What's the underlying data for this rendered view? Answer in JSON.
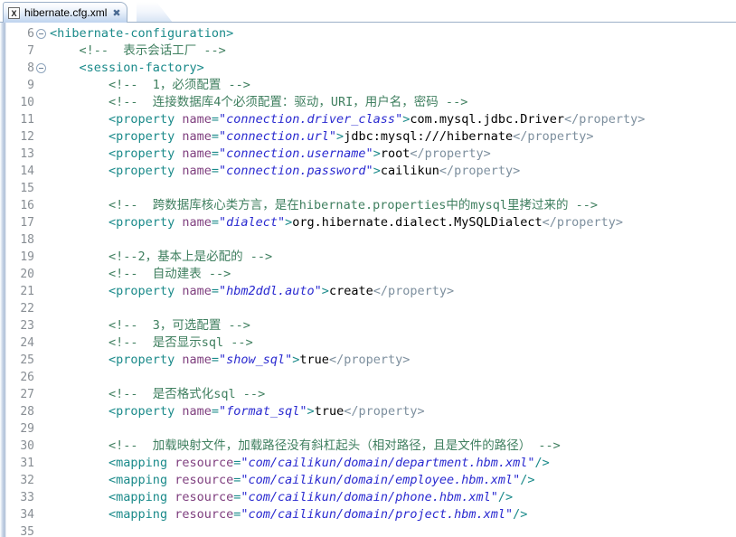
{
  "window": {
    "title": "hibernate.cfg.xml"
  },
  "tab": {
    "icon_label": "X",
    "icon_name": "xml-file-icon",
    "title": "hibernate.cfg.xml",
    "close_glyph": "✖"
  },
  "colors": {
    "comment": "#3f7f5f",
    "tag": "#1a8a8a",
    "attribute_name": "#7f3f7f",
    "attribute_value": "#2a2ad0",
    "text": "#000000",
    "closing_tag": "#7d8f9e",
    "line_number": "#888e94",
    "background": "#ffffff",
    "tab_border": "#9cb0c8"
  },
  "editor": {
    "first_line": 6,
    "last_line": 35,
    "lines": [
      {
        "number": "6",
        "fold": true,
        "indent": 0,
        "tokens": [
          {
            "t": "pn",
            "s": "<"
          },
          {
            "t": "tg",
            "s": "hibernate-configuration"
          },
          {
            "t": "pn",
            "s": ">"
          }
        ]
      },
      {
        "number": "7",
        "fold": false,
        "indent": 4,
        "tokens": [
          {
            "t": "cm",
            "s": "<!--  表示会话工厂 -->"
          }
        ]
      },
      {
        "number": "8",
        "fold": true,
        "indent": 4,
        "tokens": [
          {
            "t": "pn",
            "s": "<"
          },
          {
            "t": "tg",
            "s": "session-factory"
          },
          {
            "t": "pn",
            "s": ">"
          }
        ]
      },
      {
        "number": "9",
        "fold": false,
        "indent": 8,
        "tokens": [
          {
            "t": "cm",
            "s": "<!--  1，必须配置 -->"
          }
        ]
      },
      {
        "number": "10",
        "fold": false,
        "indent": 8,
        "tokens": [
          {
            "t": "cm",
            "s": "<!--  连接数据库4个必须配置：驱动，URI，用户名，密码 -->"
          }
        ]
      },
      {
        "number": "11",
        "fold": false,
        "indent": 8,
        "tokens": [
          {
            "t": "pn",
            "s": "<"
          },
          {
            "t": "tg",
            "s": "property"
          },
          {
            "t": "tx",
            "s": " "
          },
          {
            "t": "at",
            "s": "name"
          },
          {
            "t": "pn",
            "s": "="
          },
          {
            "t": "vl",
            "s": "\"connection.driver_class\""
          },
          {
            "t": "pn",
            "s": ">"
          },
          {
            "t": "tx",
            "s": "com.mysql.jdbc.Driver"
          },
          {
            "t": "ct",
            "s": "</property>"
          }
        ]
      },
      {
        "number": "12",
        "fold": false,
        "indent": 8,
        "tokens": [
          {
            "t": "pn",
            "s": "<"
          },
          {
            "t": "tg",
            "s": "property"
          },
          {
            "t": "tx",
            "s": " "
          },
          {
            "t": "at",
            "s": "name"
          },
          {
            "t": "pn",
            "s": "="
          },
          {
            "t": "vl",
            "s": "\"connection.url\""
          },
          {
            "t": "pn",
            "s": ">"
          },
          {
            "t": "tx",
            "s": "jdbc:mysql:///hibernate"
          },
          {
            "t": "ct",
            "s": "</property>"
          }
        ]
      },
      {
        "number": "13",
        "fold": false,
        "indent": 8,
        "tokens": [
          {
            "t": "pn",
            "s": "<"
          },
          {
            "t": "tg",
            "s": "property"
          },
          {
            "t": "tx",
            "s": " "
          },
          {
            "t": "at",
            "s": "name"
          },
          {
            "t": "pn",
            "s": "="
          },
          {
            "t": "vl",
            "s": "\"connection.username\""
          },
          {
            "t": "pn",
            "s": ">"
          },
          {
            "t": "tx",
            "s": "root"
          },
          {
            "t": "ct",
            "s": "</property>"
          }
        ]
      },
      {
        "number": "14",
        "fold": false,
        "indent": 8,
        "tokens": [
          {
            "t": "pn",
            "s": "<"
          },
          {
            "t": "tg",
            "s": "property"
          },
          {
            "t": "tx",
            "s": " "
          },
          {
            "t": "at",
            "s": "name"
          },
          {
            "t": "pn",
            "s": "="
          },
          {
            "t": "vl",
            "s": "\"connection.password\""
          },
          {
            "t": "pn",
            "s": ">"
          },
          {
            "t": "tx",
            "s": "cailikun"
          },
          {
            "t": "ct",
            "s": "</property>"
          }
        ]
      },
      {
        "number": "15",
        "fold": false,
        "indent": 0,
        "tokens": []
      },
      {
        "number": "16",
        "fold": false,
        "indent": 8,
        "tokens": [
          {
            "t": "cm",
            "s": "<!--  跨数据库核心类方言，是在hibernate.properties中的mysql里拷过来的 -->"
          }
        ]
      },
      {
        "number": "17",
        "fold": false,
        "indent": 8,
        "tokens": [
          {
            "t": "pn",
            "s": "<"
          },
          {
            "t": "tg",
            "s": "property"
          },
          {
            "t": "tx",
            "s": " "
          },
          {
            "t": "at",
            "s": "name"
          },
          {
            "t": "pn",
            "s": "="
          },
          {
            "t": "vl",
            "s": "\"dialect\""
          },
          {
            "t": "pn",
            "s": ">"
          },
          {
            "t": "tx",
            "s": "org.hibernate.dialect.MySQLDialect"
          },
          {
            "t": "ct",
            "s": "</property>"
          }
        ]
      },
      {
        "number": "18",
        "fold": false,
        "indent": 0,
        "tokens": []
      },
      {
        "number": "19",
        "fold": false,
        "indent": 8,
        "tokens": [
          {
            "t": "cm",
            "s": "<!--2，基本上是必配的 -->"
          }
        ]
      },
      {
        "number": "20",
        "fold": false,
        "indent": 8,
        "tokens": [
          {
            "t": "cm",
            "s": "<!--  自动建表 -->"
          }
        ]
      },
      {
        "number": "21",
        "fold": false,
        "indent": 8,
        "tokens": [
          {
            "t": "pn",
            "s": "<"
          },
          {
            "t": "tg",
            "s": "property"
          },
          {
            "t": "tx",
            "s": " "
          },
          {
            "t": "at",
            "s": "name"
          },
          {
            "t": "pn",
            "s": "="
          },
          {
            "t": "vl",
            "s": "\"hbm2ddl.auto\""
          },
          {
            "t": "pn",
            "s": ">"
          },
          {
            "t": "tx",
            "s": "create"
          },
          {
            "t": "ct",
            "s": "</property>"
          }
        ]
      },
      {
        "number": "22",
        "fold": false,
        "indent": 0,
        "tokens": []
      },
      {
        "number": "23",
        "fold": false,
        "indent": 8,
        "tokens": [
          {
            "t": "cm",
            "s": "<!--  3，可选配置 -->"
          }
        ]
      },
      {
        "number": "24",
        "fold": false,
        "indent": 8,
        "tokens": [
          {
            "t": "cm",
            "s": "<!--  是否显示sql -->"
          }
        ]
      },
      {
        "number": "25",
        "fold": false,
        "indent": 8,
        "tokens": [
          {
            "t": "pn",
            "s": "<"
          },
          {
            "t": "tg",
            "s": "property"
          },
          {
            "t": "tx",
            "s": " "
          },
          {
            "t": "at",
            "s": "name"
          },
          {
            "t": "pn",
            "s": "="
          },
          {
            "t": "vl",
            "s": "\"show_sql\""
          },
          {
            "t": "pn",
            "s": ">"
          },
          {
            "t": "tx",
            "s": "true"
          },
          {
            "t": "ct",
            "s": "</property>"
          }
        ]
      },
      {
        "number": "26",
        "fold": false,
        "indent": 0,
        "tokens": []
      },
      {
        "number": "27",
        "fold": false,
        "indent": 8,
        "tokens": [
          {
            "t": "cm",
            "s": "<!--  是否格式化sql -->"
          }
        ]
      },
      {
        "number": "28",
        "fold": false,
        "indent": 8,
        "tokens": [
          {
            "t": "pn",
            "s": "<"
          },
          {
            "t": "tg",
            "s": "property"
          },
          {
            "t": "tx",
            "s": " "
          },
          {
            "t": "at",
            "s": "name"
          },
          {
            "t": "pn",
            "s": "="
          },
          {
            "t": "vl",
            "s": "\"format_sql\""
          },
          {
            "t": "pn",
            "s": ">"
          },
          {
            "t": "tx",
            "s": "true"
          },
          {
            "t": "ct",
            "s": "</property>"
          }
        ]
      },
      {
        "number": "29",
        "fold": false,
        "indent": 0,
        "tokens": []
      },
      {
        "number": "30",
        "fold": false,
        "indent": 8,
        "tokens": [
          {
            "t": "cm",
            "s": "<!--  加载映射文件，加载路径没有斜杠起头（相对路径，且是文件的路径） -->"
          }
        ]
      },
      {
        "number": "31",
        "fold": false,
        "indent": 8,
        "tokens": [
          {
            "t": "pn",
            "s": "<"
          },
          {
            "t": "tg",
            "s": "mapping"
          },
          {
            "t": "tx",
            "s": " "
          },
          {
            "t": "at",
            "s": "resource"
          },
          {
            "t": "pn",
            "s": "="
          },
          {
            "t": "vl",
            "s": "\"com/cailikun/domain/department.hbm.xml\""
          },
          {
            "t": "pn",
            "s": "/>"
          }
        ]
      },
      {
        "number": "32",
        "fold": false,
        "indent": 8,
        "tokens": [
          {
            "t": "pn",
            "s": "<"
          },
          {
            "t": "tg",
            "s": "mapping"
          },
          {
            "t": "tx",
            "s": " "
          },
          {
            "t": "at",
            "s": "resource"
          },
          {
            "t": "pn",
            "s": "="
          },
          {
            "t": "vl",
            "s": "\"com/cailikun/domain/employee.hbm.xml\""
          },
          {
            "t": "pn",
            "s": "/>"
          }
        ]
      },
      {
        "number": "33",
        "fold": false,
        "indent": 8,
        "tokens": [
          {
            "t": "pn",
            "s": "<"
          },
          {
            "t": "tg",
            "s": "mapping"
          },
          {
            "t": "tx",
            "s": " "
          },
          {
            "t": "at",
            "s": "resource"
          },
          {
            "t": "pn",
            "s": "="
          },
          {
            "t": "vl",
            "s": "\"com/cailikun/domain/phone.hbm.xml\""
          },
          {
            "t": "pn",
            "s": "/>"
          }
        ]
      },
      {
        "number": "34",
        "fold": false,
        "indent": 8,
        "tokens": [
          {
            "t": "pn",
            "s": "<"
          },
          {
            "t": "tg",
            "s": "mapping"
          },
          {
            "t": "tx",
            "s": " "
          },
          {
            "t": "at",
            "s": "resource"
          },
          {
            "t": "pn",
            "s": "="
          },
          {
            "t": "vl",
            "s": "\"com/cailikun/domain/project.hbm.xml\""
          },
          {
            "t": "pn",
            "s": "/>"
          }
        ]
      },
      {
        "number": "35",
        "fold": false,
        "indent": 0,
        "tokens": []
      }
    ]
  }
}
